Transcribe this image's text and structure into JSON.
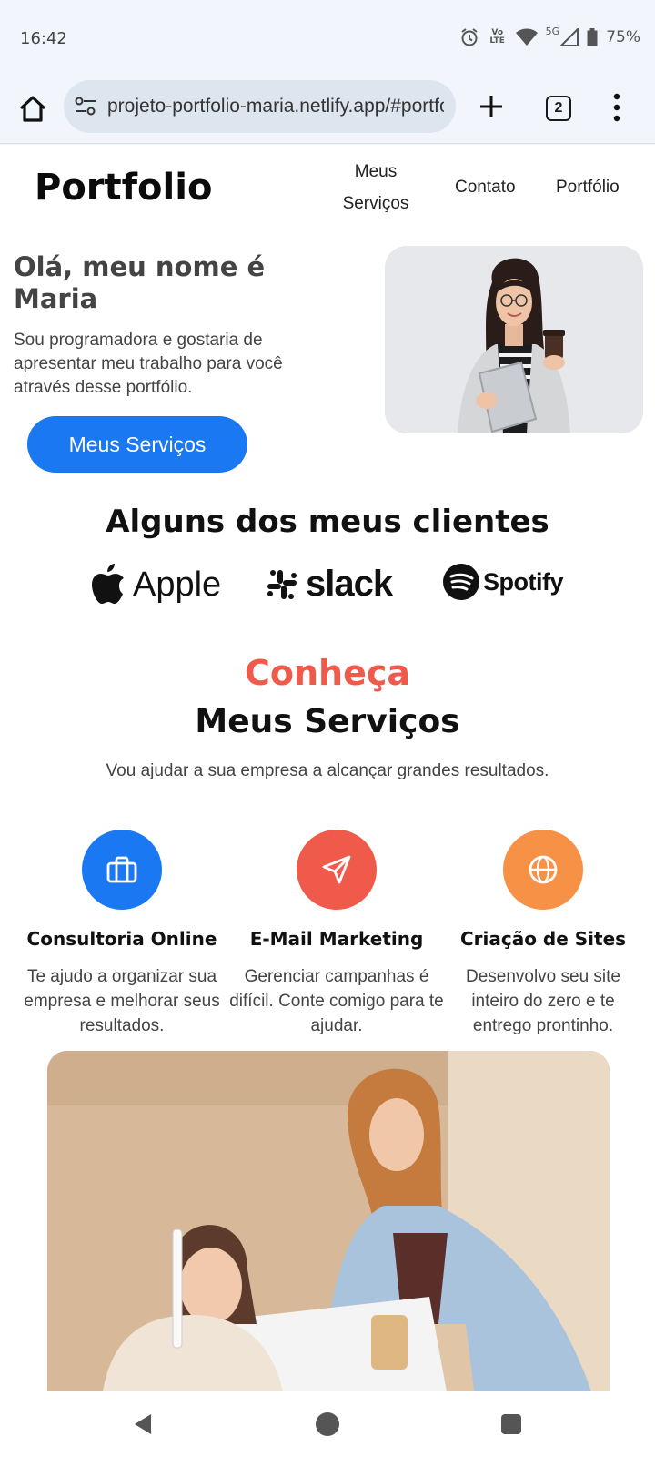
{
  "status_bar": {
    "time": "16:42",
    "network_label": "5G",
    "lte_label": "Vo LTE",
    "battery": "75%"
  },
  "browser": {
    "url": "projeto-portfolio-maria.netlify.app/#portfolio",
    "tab_count": "2",
    "icons": [
      "home-icon",
      "site-settings-icon",
      "new-tab-icon",
      "tab-switcher-icon",
      "more-menu-icon"
    ]
  },
  "header": {
    "logo": "Portfolio",
    "nav": {
      "services_line1": "Meus",
      "services_line2": "Serviços",
      "contact": "Contato",
      "portfolio": "Portfólio"
    }
  },
  "hero": {
    "title": "Olá, meu nome é Maria",
    "text": "Sou programadora e gostaria de apresentar meu trabalho para você através desse portfólio.",
    "button": "Meus Serviços"
  },
  "clients": {
    "title": "Alguns dos meus clientes",
    "apple": "Apple",
    "slack": "slack",
    "spotify": "Spotify"
  },
  "services": {
    "eyebrow": "Conheça",
    "title": "Meus Serviços",
    "subtitle": "Vou ajudar a sua empresa a alcançar grandes resultados.",
    "items": [
      {
        "name": "Consultoria Online",
        "desc": "Te ajudo a organizar sua empresa e melhorar seus resultados.",
        "icon": "briefcase-icon",
        "color": "#1a78f2"
      },
      {
        "name": "E-Mail Marketing",
        "desc": "Gerenciar campanhas é difícil. Conte comigo para te ajudar.",
        "icon": "send-icon",
        "color": "#f05a4b"
      },
      {
        "name": "Criação de Sites",
        "desc": "Desenvolvo seu site inteiro do zero e te entrego prontinho.",
        "icon": "globe-icon",
        "color": "#f79145"
      }
    ]
  },
  "colors": {
    "accent_blue": "#1a78f2",
    "accent_red": "#f05a4b",
    "accent_orange": "#f79145"
  }
}
